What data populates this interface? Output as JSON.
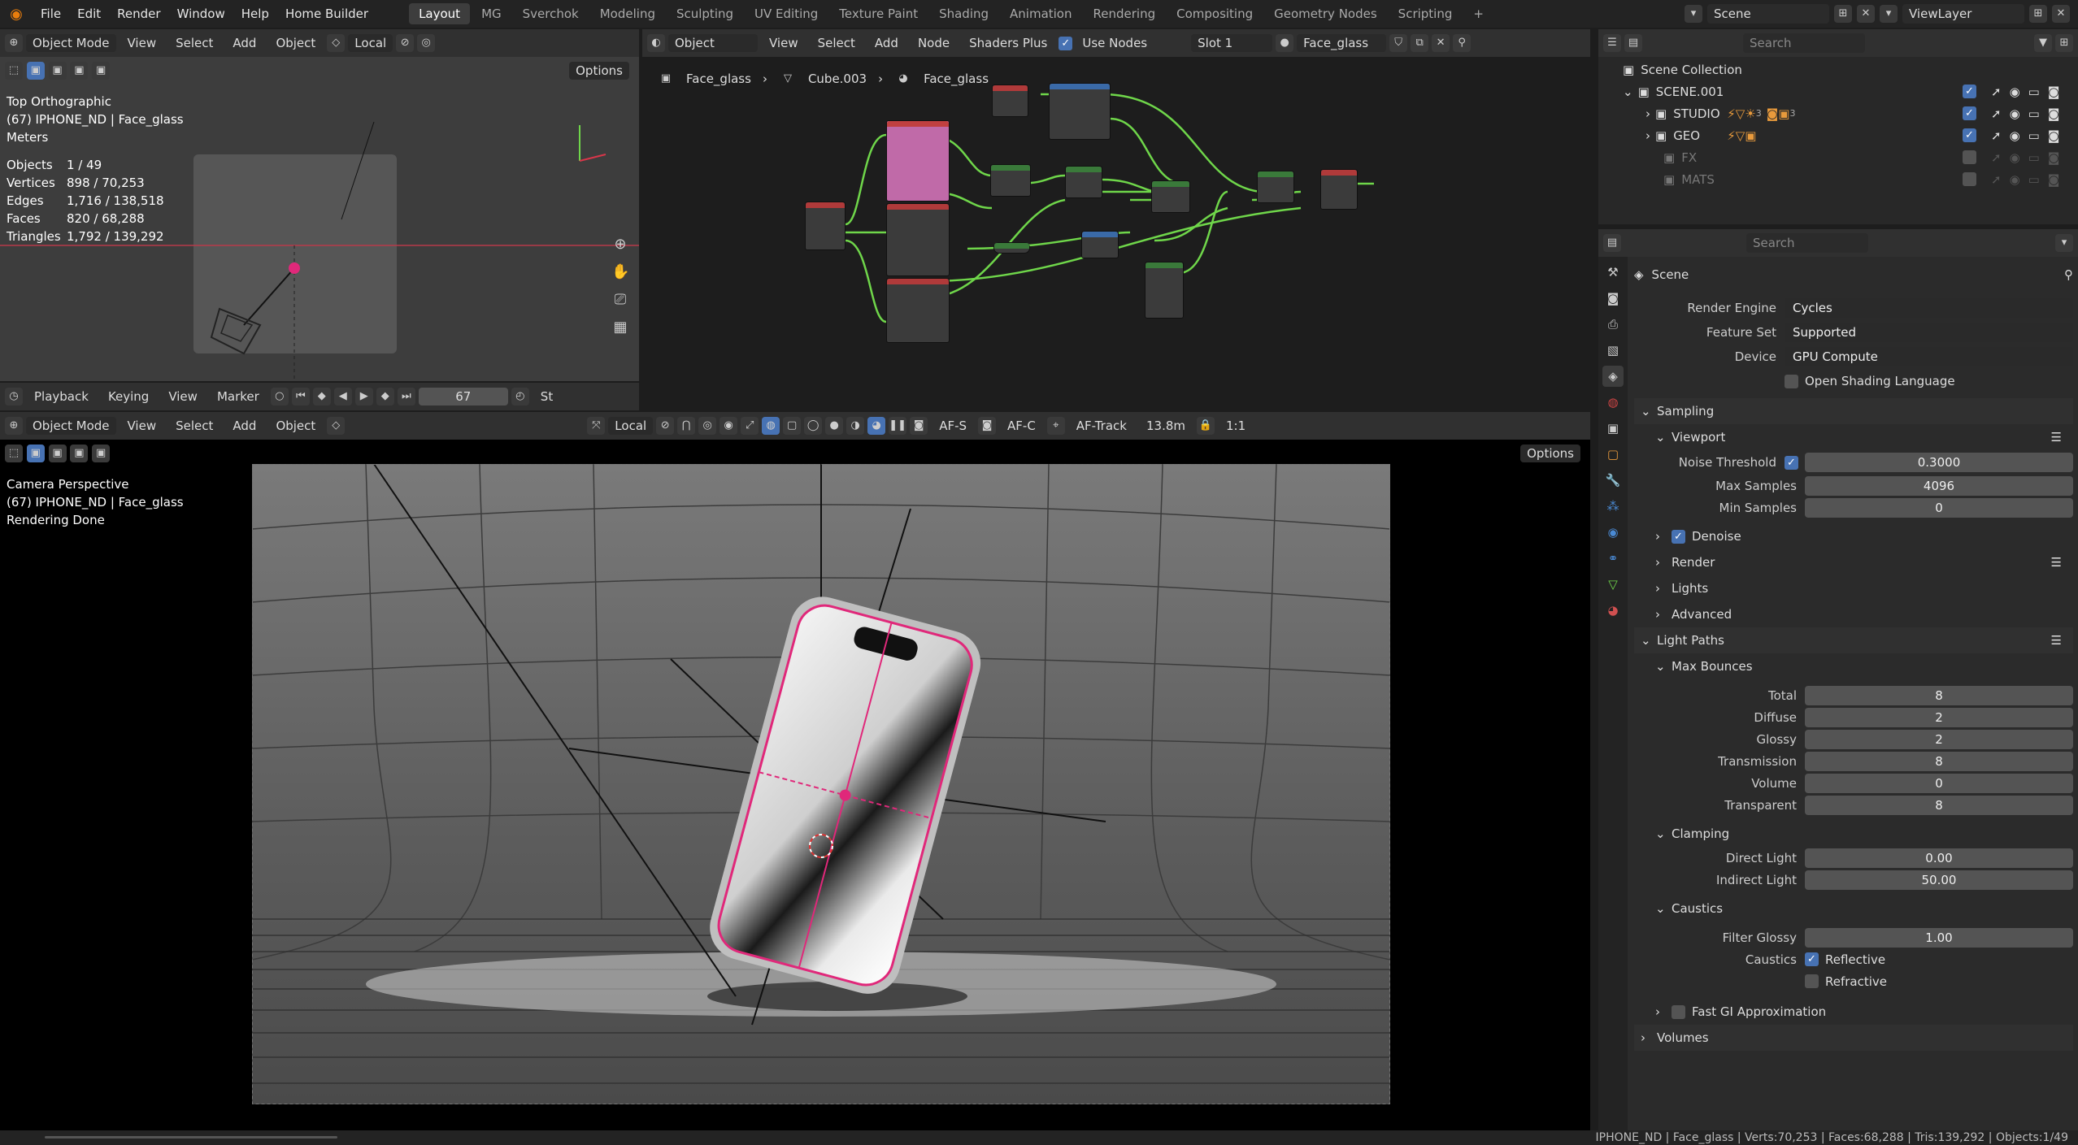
{
  "topbar": {
    "menus": [
      "File",
      "Edit",
      "Render",
      "Window",
      "Help",
      "Home Builder"
    ],
    "workspaces": [
      "Layout",
      "MG",
      "Sverchok",
      "Modeling",
      "Sculpting",
      "UV Editing",
      "Texture Paint",
      "Shading",
      "Animation",
      "Rendering",
      "Compositing",
      "Geometry Nodes",
      "Scripting"
    ],
    "active_workspace": "Layout",
    "scene": "Scene",
    "view_layer": "ViewLayer"
  },
  "top_viewport": {
    "mode": "Object Mode",
    "menus": [
      "View",
      "Select",
      "Add",
      "Object"
    ],
    "orientation": "Local",
    "options": "Options",
    "view_name": "Top Orthographic",
    "object_info": "(67) IPHONE_ND | Face_glass",
    "units": "Meters",
    "stats": [
      {
        "label": "Objects",
        "value": "1 / 49"
      },
      {
        "label": "Vertices",
        "value": "898 / 70,253"
      },
      {
        "label": "Edges",
        "value": "1,716 / 138,518"
      },
      {
        "label": "Faces",
        "value": "820 / 68,288"
      },
      {
        "label": "Triangles",
        "value": "1,792 / 139,292"
      }
    ]
  },
  "timeline": {
    "menus": [
      "Playback",
      "Keying",
      "View",
      "Marker"
    ],
    "frame": "67",
    "start_label": "St"
  },
  "node_editor": {
    "editor_type": "Object",
    "menus": [
      "View",
      "Select",
      "Add",
      "Node",
      "Shaders Plus"
    ],
    "use_nodes_label": "Use Nodes",
    "slot": "Slot 1",
    "material": "Face_glass",
    "breadcrumb": [
      "Face_glass",
      "Cube.003",
      "Face_glass"
    ]
  },
  "main_viewport": {
    "mode": "Object Mode",
    "menus": [
      "View",
      "Select",
      "Add",
      "Object"
    ],
    "orientation": "Local",
    "af_s": "AF-S",
    "af_c": "AF-C",
    "af_track": "AF-Track",
    "distance": "13.8m",
    "ratio": "1:1",
    "options": "Options",
    "view_name": "Camera Perspective",
    "object_info": "(67) IPHONE_ND | Face_glass",
    "render_status": "Rendering Done"
  },
  "outliner": {
    "search_placeholder": "Search",
    "root": "Scene Collection",
    "items": [
      {
        "name": "SCENE.001",
        "level": 0
      },
      {
        "name": "STUDIO",
        "level": 1
      },
      {
        "name": "GEO",
        "level": 1
      },
      {
        "name": "FX",
        "level": 1
      },
      {
        "name": "MATS",
        "level": 1
      }
    ],
    "studio_count": "3",
    "studio_count2": "3"
  },
  "properties": {
    "search_placeholder": "Search",
    "context": "Scene",
    "render_engine_label": "Render Engine",
    "render_engine": "Cycles",
    "feature_set_label": "Feature Set",
    "feature_set": "Supported",
    "device_label": "Device",
    "device": "GPU Compute",
    "osl_label": "Open Shading Language",
    "sampling": "Sampling",
    "viewport": "Viewport",
    "noise_threshold_label": "Noise Threshold",
    "noise_threshold": "0.3000",
    "max_samples_label": "Max Samples",
    "max_samples": "4096",
    "min_samples_label": "Min Samples",
    "min_samples": "0",
    "denoise": "Denoise",
    "render": "Render",
    "lights": "Lights",
    "advanced": "Advanced",
    "light_paths": "Light Paths",
    "max_bounces": "Max Bounces",
    "bounces": [
      {
        "label": "Total",
        "value": "8"
      },
      {
        "label": "Diffuse",
        "value": "2"
      },
      {
        "label": "Glossy",
        "value": "2"
      },
      {
        "label": "Transmission",
        "value": "8"
      },
      {
        "label": "Volume",
        "value": "0"
      },
      {
        "label": "Transparent",
        "value": "8"
      }
    ],
    "clamping": "Clamping",
    "direct_light_label": "Direct Light",
    "direct_light": "0.00",
    "indirect_light_label": "Indirect Light",
    "indirect_light": "50.00",
    "caustics": "Caustics",
    "filter_glossy_label": "Filter Glossy",
    "filter_glossy": "1.00",
    "caustics_label": "Caustics",
    "reflective": "Reflective",
    "refractive": "Refractive",
    "fast_gi": "Fast GI Approximation",
    "volumes": "Volumes"
  },
  "statusbar": {
    "text": "IPHONE_ND | Face_glass | Verts:70,253 | Faces:68,288 | Tris:139,292 | Objects:1/49"
  },
  "colors": {
    "accent": "#4772b3",
    "selection": "#e0287a",
    "node_link": "#6fd64a"
  }
}
